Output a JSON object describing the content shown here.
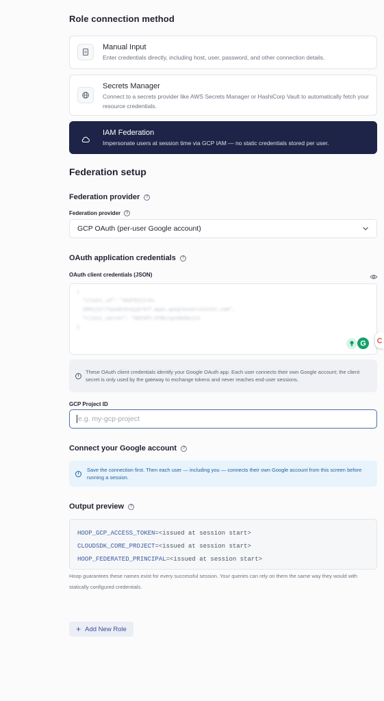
{
  "role_connection": {
    "title": "Role connection method",
    "options": [
      {
        "title": "Manual Input",
        "desc": "Enter credentials directly, including host, user, password, and other connection details.",
        "icon": "document-icon",
        "selected": false
      },
      {
        "title": "Secrets Manager",
        "desc": "Connect to a secrets provider like AWS Secrets Manager or HashiCorp Vault to automatically fetch your resource credentials.",
        "icon": "globe-lock-icon",
        "selected": false
      },
      {
        "title": "IAM Federation",
        "desc": "Impersonate users at session time via GCP IAM — no static credentials stored per user.",
        "icon": "cloud-icon",
        "selected": true
      }
    ]
  },
  "federation": {
    "title": "Federation setup",
    "provider_heading": "Federation provider",
    "provider_label": "Federation provider",
    "provider_value": "GCP OAuth (per-user Google account)",
    "oauth_heading": "OAuth application credentials",
    "oauth_label": "OAuth client credentials (JSON)",
    "oauth_note": "These OAuth client credentials identify your Google OAuth app. Each user connects their own Google account; the client secret is only used by the gateway to exchange tokens and never reaches end-user sessions.",
    "project_label": "GCP Project ID",
    "project_placeholder": "e.g. my-gcp-project",
    "connect_heading": "Connect your Google account",
    "connect_note": "Save the connection first. Then each user — including you — connects their own Google account from this screen before running a session.",
    "preview_heading": "Output preview",
    "preview_lines": [
      {
        "key": "HOOP_GCP_ACCESS_TOKEN",
        "value": "=<issued at session start>"
      },
      {
        "key": "CLOUDSDK_CORE_PROJECT",
        "value": "=<issued at session start>"
      },
      {
        "key": "HOOP_FEDERATED_PRINCIPAL",
        "value": "=<issued at session start>"
      }
    ],
    "preview_footer": "Hoop guarantees these names exist for every successful session. Your queries can rely on them the same way they would with statically configured credentials."
  },
  "add_role_label": "Add New Role",
  "colors": {
    "selected_card": "#1d2447",
    "accent": "#3b4f9a",
    "info_blue": "#1d5f9e"
  }
}
